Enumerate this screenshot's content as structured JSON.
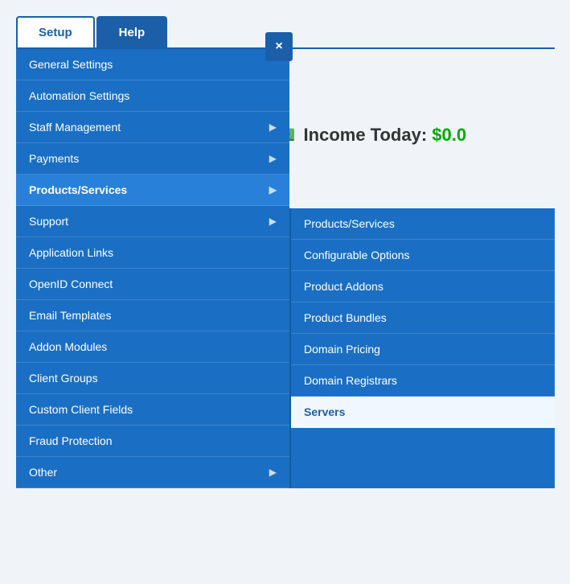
{
  "header": {
    "tab_setup": "Setup",
    "tab_help": "Help",
    "close_label": "×"
  },
  "income": {
    "icon": "💵",
    "label": "Income Today:",
    "value": "$0.0"
  },
  "primary_menu": {
    "items": [
      {
        "id": "general-settings",
        "label": "General Settings",
        "has_arrow": false,
        "active": false
      },
      {
        "id": "automation-settings",
        "label": "Automation Settings",
        "has_arrow": false,
        "active": false
      },
      {
        "id": "staff-management",
        "label": "Staff Management",
        "has_arrow": true,
        "active": false
      },
      {
        "id": "payments",
        "label": "Payments",
        "has_arrow": true,
        "active": false
      },
      {
        "id": "products-services",
        "label": "Products/Services",
        "has_arrow": true,
        "active": true
      },
      {
        "id": "support",
        "label": "Support",
        "has_arrow": true,
        "active": false
      },
      {
        "id": "application-links",
        "label": "Application Links",
        "has_arrow": false,
        "active": false
      },
      {
        "id": "openid-connect",
        "label": "OpenID Connect",
        "has_arrow": false,
        "active": false
      },
      {
        "id": "email-templates",
        "label": "Email Templates",
        "has_arrow": false,
        "active": false
      },
      {
        "id": "addon-modules",
        "label": "Addon Modules",
        "has_arrow": false,
        "active": false
      },
      {
        "id": "client-groups",
        "label": "Client Groups",
        "has_arrow": false,
        "active": false
      },
      {
        "id": "custom-client-fields",
        "label": "Custom Client Fields",
        "has_arrow": false,
        "active": false
      },
      {
        "id": "fraud-protection",
        "label": "Fraud Protection",
        "has_arrow": false,
        "active": false
      },
      {
        "id": "other",
        "label": "Other",
        "has_arrow": true,
        "active": false
      }
    ]
  },
  "secondary_menu": {
    "items": [
      {
        "id": "ps-products-services",
        "label": "Products/Services",
        "highlighted": false
      },
      {
        "id": "ps-configurable-options",
        "label": "Configurable Options",
        "highlighted": false
      },
      {
        "id": "ps-product-addons",
        "label": "Product Addons",
        "highlighted": false
      },
      {
        "id": "ps-product-bundles",
        "label": "Product Bundles",
        "highlighted": false
      },
      {
        "id": "ps-domain-pricing",
        "label": "Domain Pricing",
        "highlighted": false
      },
      {
        "id": "ps-domain-registrars",
        "label": "Domain Registrars",
        "highlighted": false
      },
      {
        "id": "ps-servers",
        "label": "Servers",
        "highlighted": true
      }
    ]
  }
}
